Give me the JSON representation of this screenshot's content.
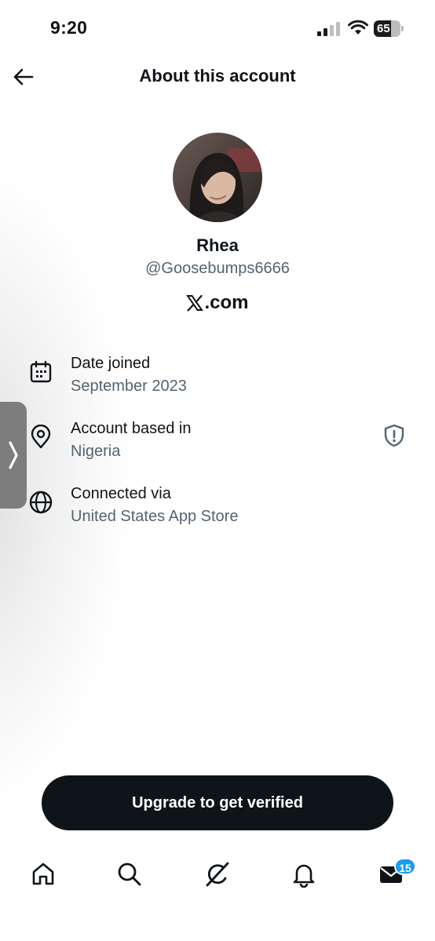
{
  "status_bar": {
    "time": "9:20",
    "battery_level": "65",
    "battery_fraction": 0.65
  },
  "header": {
    "title": "About this account",
    "back_icon": "arrow-left-icon"
  },
  "profile": {
    "name": "Rhea",
    "handle": "@Goosebumps6666",
    "site_logo": "X",
    "site_suffix": ".com"
  },
  "info": [
    {
      "icon": "calendar-icon",
      "label": "Date joined",
      "value": "September 2023"
    },
    {
      "icon": "location-pin-icon",
      "label": "Account based in",
      "value": "Nigeria",
      "extra_icon": "shield-icon"
    },
    {
      "icon": "globe-icon",
      "label": "Connected via",
      "value": "United States App Store"
    }
  ],
  "cta": {
    "label": "Upgrade to get verified"
  },
  "nav": {
    "items": [
      "home-icon",
      "search-icon",
      "grok-icon",
      "notifications-bell-icon",
      "messages-envelope-icon"
    ],
    "messages_badge": "15"
  },
  "colors": {
    "primary_text": "#0f1419",
    "secondary_text": "#536471",
    "badge_blue": "#1d9bf0",
    "cta_background": "#0f1419"
  }
}
